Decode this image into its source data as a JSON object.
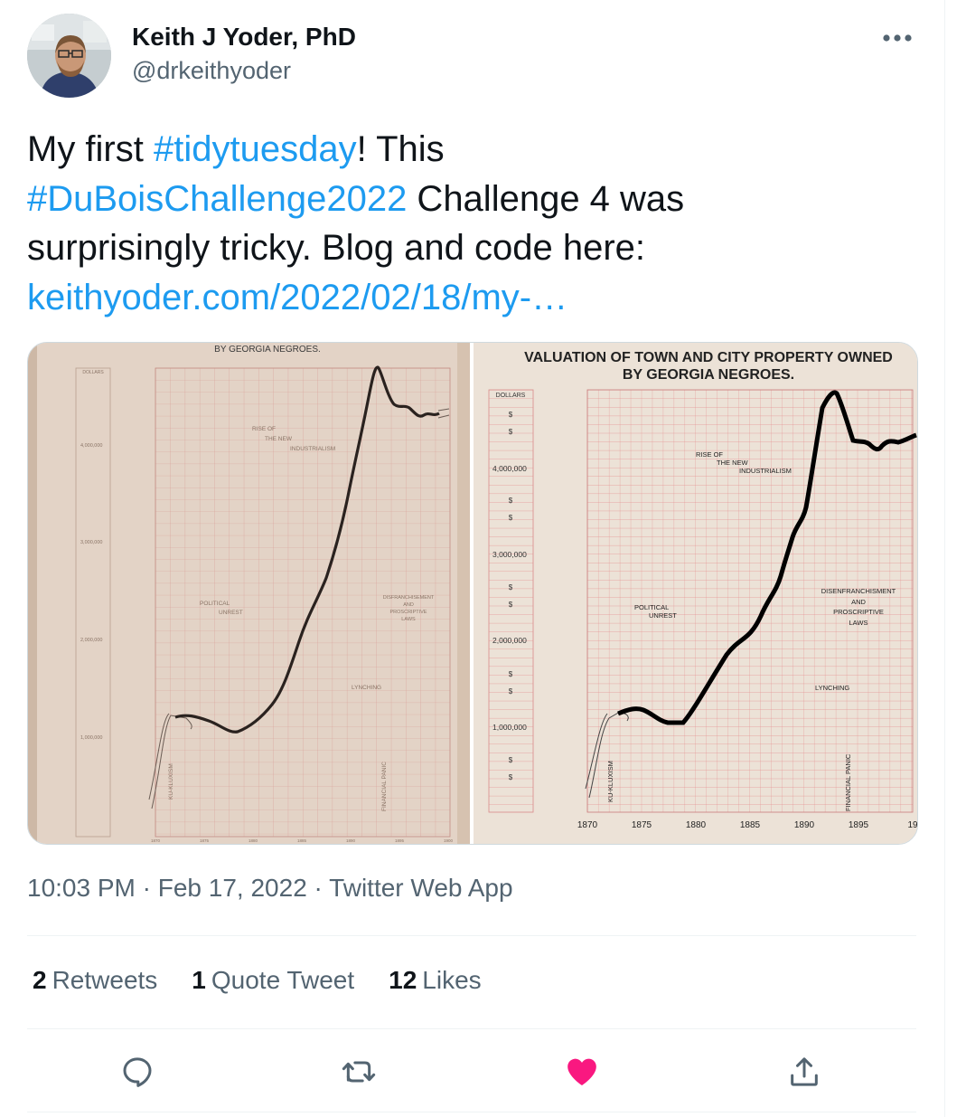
{
  "author": {
    "name": "Keith J Yoder, PhD",
    "handle": "@drkeithyoder"
  },
  "tweet": {
    "line1_pre": "My first ",
    "line1_link": "#tidytuesday",
    "line1_post": "! This",
    "line2_link": "#DuBoisChallenge2022",
    "line2_post": " Challenge 4 was",
    "line3": "surprisingly tricky. Blog and code here:",
    "line4_link": "keithyoder.com/2022/02/18/my-…"
  },
  "media": {
    "left": {
      "title": "BY GEORGIA NEGROES.",
      "unit": "DOLLARS",
      "ylabels": [
        "4,000,000",
        "3,000,000",
        "2,000,000",
        "1,000,000"
      ],
      "ann_rise": [
        "RISE OF",
        "THE NEW",
        "INDUSTRIALISM"
      ],
      "ann_political": [
        "POLITICAL",
        "UNREST"
      ],
      "ann_disfranchise": [
        "DISFRANCHISEMENT",
        "AND",
        "PROSCRIPTIVE",
        "LAWS"
      ],
      "ann_lynching": "LYNCHING",
      "ann_kkk": "KU-KLUXISM",
      "ann_panic": "FINANCIAL PANIC",
      "xlabels": [
        "1870",
        "1875",
        "1880",
        "1885",
        "1890",
        "1895",
        "1900"
      ]
    },
    "right": {
      "title1": "VALUATION OF TOWN AND CITY PROPERTY OWNED",
      "title2": "BY GEORGIA NEGROES.",
      "unit": "DOLLARS",
      "dollar_sign": "$",
      "ylabels": [
        "4,000,000",
        "3,000,000",
        "2,000,000",
        "1,000,000"
      ],
      "ann_rise": [
        "RISE OF",
        "THE NEW",
        "INDUSTRIALISM"
      ],
      "ann_political": [
        "POLITICAL",
        "UNREST"
      ],
      "ann_disfranchise": [
        "DISENFRANCHISMENT",
        "AND",
        "PROSCRIPTIVE",
        "LAWS"
      ],
      "ann_lynching": "LYNCHING",
      "ann_kkk": "KU-KLUXISM",
      "ann_panic": "FINANCIAL PANIC",
      "xlabels": [
        "1870",
        "1875",
        "1880",
        "1885",
        "1890",
        "1895",
        "19"
      ]
    }
  },
  "meta": {
    "time": "10:03 PM",
    "sep": " · ",
    "date": "Feb 17, 2022",
    "source": "Twitter Web App"
  },
  "stats": {
    "retweets_count": "2",
    "retweets_label": "Retweets",
    "quotes_count": "1",
    "quotes_label": "Quote Tweet",
    "likes_count": "12",
    "likes_label": "Likes"
  },
  "colors": {
    "link": "#1d9bf0",
    "like_active": "#f91880",
    "secondary_text": "#536471",
    "grid_red": "#e07a7a"
  },
  "icons": {
    "more": "more-icon",
    "reply": "reply-icon",
    "retweet": "retweet-icon",
    "like": "like-icon",
    "share": "share-icon"
  }
}
